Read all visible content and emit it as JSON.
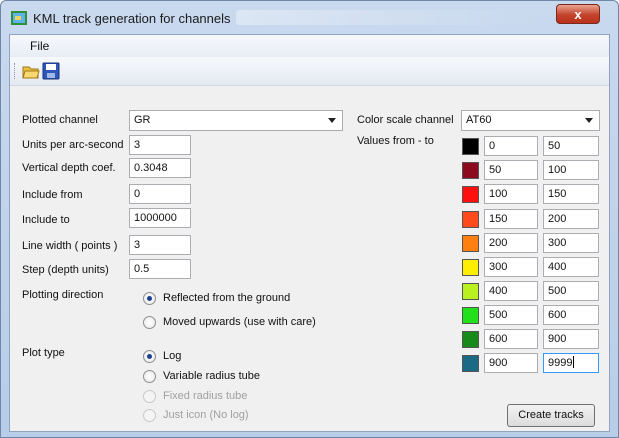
{
  "window": {
    "title": "KML track generation for channels",
    "close_label": "x"
  },
  "menu": {
    "file": "File"
  },
  "toolbar": {
    "buttons": [
      {
        "icon": "open-folder-icon"
      },
      {
        "icon": "save-disk-icon"
      }
    ]
  },
  "form": {
    "plotted_channel": {
      "label": "Plotted channel",
      "value": "GR"
    },
    "units_per_arc_second": {
      "label": "Units per arc-second",
      "value": "3"
    },
    "vertical_depth_coef": {
      "label": "Vertical depth coef.",
      "value": "0.3048"
    },
    "include_from": {
      "label": "Include from",
      "value": "0"
    },
    "include_to": {
      "label": "Include to",
      "value": "1000000"
    },
    "line_width": {
      "label": "Line width ( points )",
      "value": "3"
    },
    "step": {
      "label": "Step (depth units)",
      "value": "0.5"
    },
    "plotting_direction": {
      "label": "Plotting direction",
      "options": [
        "Reflected from the ground",
        "Moved upwards (use with care)"
      ],
      "selected": 0
    },
    "plot_type": {
      "label": "Plot type",
      "options": [
        "Log",
        "Variable radius tube",
        "Fixed radius tube",
        "Just icon (No log)"
      ],
      "selected": 0,
      "disabled": [
        false,
        false,
        true,
        true
      ]
    }
  },
  "color_scale": {
    "label": "Color scale channel",
    "value": "AT60",
    "values_label": "Values from - to",
    "rows": [
      {
        "color": "#000000",
        "from": "0",
        "to": "50"
      },
      {
        "color": "#8b0a1e",
        "from": "50",
        "to": "100"
      },
      {
        "color": "#ff1010",
        "from": "100",
        "to": "150"
      },
      {
        "color": "#ff4a1c",
        "from": "150",
        "to": "200"
      },
      {
        "color": "#ff7f10",
        "from": "200",
        "to": "300"
      },
      {
        "color": "#ffee00",
        "from": "300",
        "to": "400"
      },
      {
        "color": "#b8f020",
        "from": "400",
        "to": "500"
      },
      {
        "color": "#22e01a",
        "from": "500",
        "to": "600"
      },
      {
        "color": "#178a1a",
        "from": "600",
        "to": "900"
      },
      {
        "color": "#1a6a86",
        "from": "900",
        "to": "9999"
      }
    ]
  },
  "actions": {
    "create_tracks": "Create tracks"
  }
}
